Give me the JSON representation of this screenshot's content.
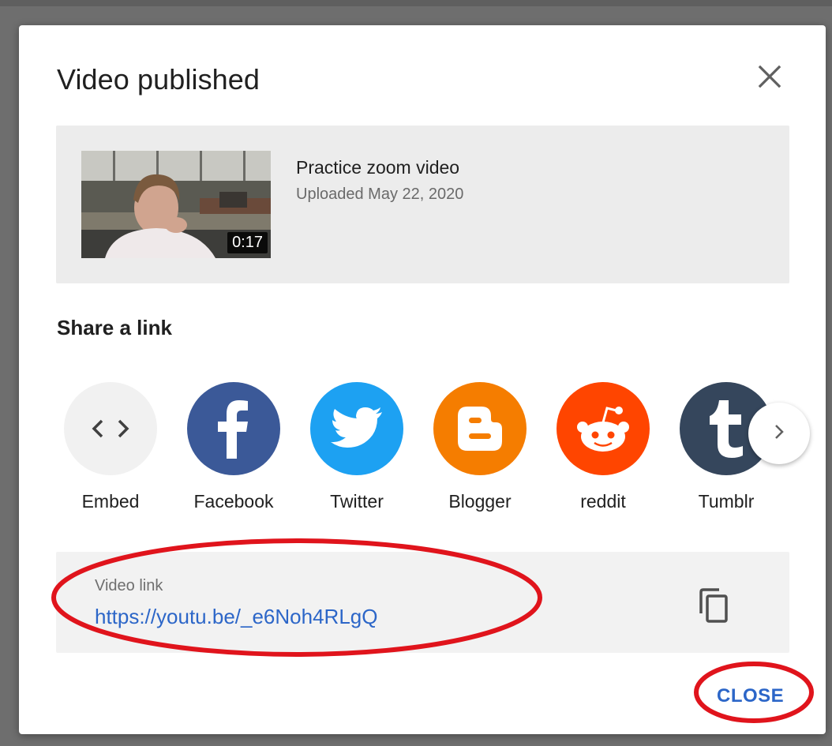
{
  "dialog": {
    "title": "Video published",
    "close_icon": "close-icon"
  },
  "video": {
    "title": "Practice zoom video",
    "uploaded": "Uploaded May 22, 2020",
    "duration": "0:17"
  },
  "share": {
    "heading": "Share a link",
    "items": [
      {
        "label": "Embed",
        "icon": "embed-icon",
        "color": "#f1f1f1"
      },
      {
        "label": "Facebook",
        "icon": "facebook-icon",
        "color": "#3b5998"
      },
      {
        "label": "Twitter",
        "icon": "twitter-icon",
        "color": "#1da1f2"
      },
      {
        "label": "Blogger",
        "icon": "blogger-icon",
        "color": "#f57d00"
      },
      {
        "label": "reddit",
        "icon": "reddit-icon",
        "color": "#ff4500"
      },
      {
        "label": "Tumblr",
        "icon": "tumblr-icon",
        "color": "#35465c"
      }
    ],
    "next_icon": "chevron-right-icon"
  },
  "link": {
    "label": "Video link",
    "url": "https://youtu.be/_e6Noh4RLgQ",
    "copy_icon": "copy-icon"
  },
  "footer": {
    "close_label": "CLOSE"
  },
  "colors": {
    "accent": "#2c66c8",
    "annotation": "#e0141c"
  }
}
